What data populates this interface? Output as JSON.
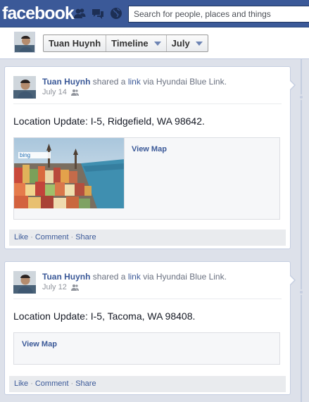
{
  "topbar": {
    "logo": "facebook",
    "search_placeholder": "Search for people, places and things",
    "icons": [
      "friend-requests-icon",
      "messages-icon",
      "notifications-globe-icon"
    ]
  },
  "timeline_header": {
    "name": "Tuan Huynh",
    "section": "Timeline",
    "month": "July"
  },
  "posts": [
    {
      "author": "Tuan Huynh",
      "verb": "shared a",
      "link_word": "link",
      "via": "via Hyundai Blue Link.",
      "date": "July 14",
      "privacy_icon": "friends-icon",
      "text": "Location Update: I-5, Ridgefield, WA 98642.",
      "attachment": {
        "has_map": true,
        "map_logo": "bing",
        "link_label": "View Map"
      },
      "actions": [
        "Like",
        "Comment",
        "Share"
      ]
    },
    {
      "author": "Tuan Huynh",
      "verb": "shared a",
      "link_word": "link",
      "via": "via Hyundai Blue Link.",
      "date": "July 12",
      "privacy_icon": "friends-icon",
      "text": "Location Update: I-5, Tacoma, WA 98408.",
      "attachment": {
        "has_map": false,
        "link_label": "View Map"
      },
      "actions": [
        "Like",
        "Comment",
        "Share"
      ]
    }
  ],
  "colors": {
    "brand_blue": "#3b5998",
    "link_blue": "#3b5998",
    "page_bg": "#dde1ea",
    "action_bar": "#e9ebee"
  }
}
